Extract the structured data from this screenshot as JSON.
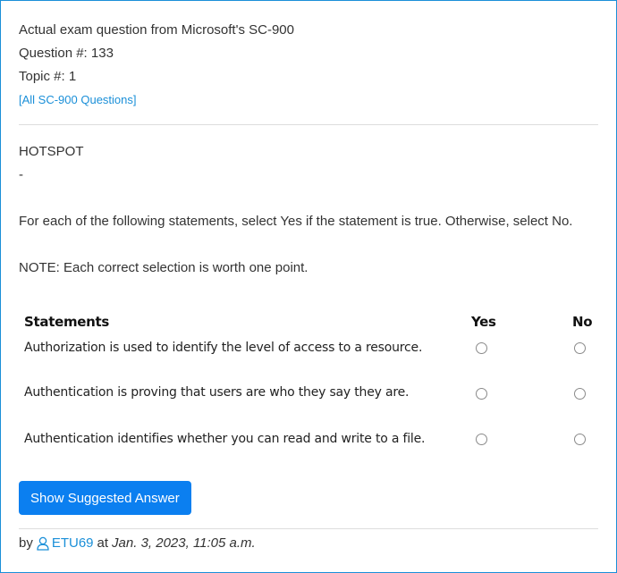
{
  "header": {
    "title": "Actual exam question from Microsoft's SC-900",
    "question_number": "Question #: 133",
    "topic": "Topic #: 1",
    "all_questions_link": "[All SC-900 Questions]"
  },
  "question": {
    "type": "HOTSPOT",
    "separator": "-",
    "instruction": "For each of the following statements, select Yes if the statement is true. Otherwise, select No.",
    "note": "NOTE: Each correct selection is worth one point."
  },
  "table": {
    "headers": {
      "statements": "Statements",
      "yes": "Yes",
      "no": "No"
    },
    "rows": [
      {
        "statement": "Authorization is used to identify the level of access to a resource."
      },
      {
        "statement": "Authentication is proving that users are who they say they are."
      },
      {
        "statement": "Authentication identifies whether you can read and write to a file."
      }
    ]
  },
  "actions": {
    "show_answer_label": "Show Suggested Answer"
  },
  "footer": {
    "by": "by",
    "user": "ETU69",
    "at": "at",
    "date": "Jan. 3, 2023, 11:05 a.m."
  },
  "colors": {
    "accent": "#1a8fd8",
    "button": "#0b7ff0"
  },
  "icons": {
    "user": "user-icon",
    "radio": "radio-icon"
  }
}
